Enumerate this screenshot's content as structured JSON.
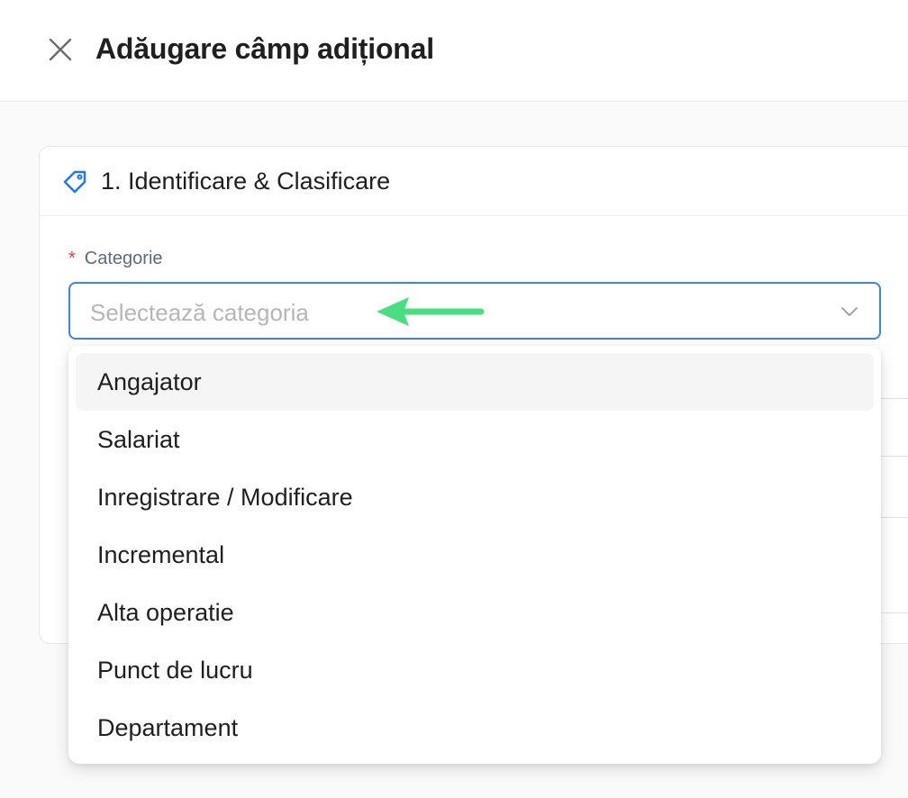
{
  "header": {
    "title": "Adăugare câmp adițional",
    "close_icon": "close-icon"
  },
  "section": {
    "title": "1. Identificare & Clasificare",
    "icon": "tag-icon"
  },
  "field": {
    "required_marker": "*",
    "label": "Categorie",
    "placeholder": "Selectează categoria"
  },
  "dropdown": {
    "options": [
      {
        "label": "Angajator",
        "highlighted": true
      },
      {
        "label": "Salariat",
        "highlighted": false
      },
      {
        "label": "Inregistrare / Modificare",
        "highlighted": false
      },
      {
        "label": "Incremental",
        "highlighted": false
      },
      {
        "label": "Alta operatie",
        "highlighted": false
      },
      {
        "label": "Punct de lucru",
        "highlighted": false
      },
      {
        "label": "Departament",
        "highlighted": false
      }
    ]
  },
  "colors": {
    "accent": "#3b82f6",
    "required": "#e53935",
    "annotation_arrow": "#4ade80"
  }
}
